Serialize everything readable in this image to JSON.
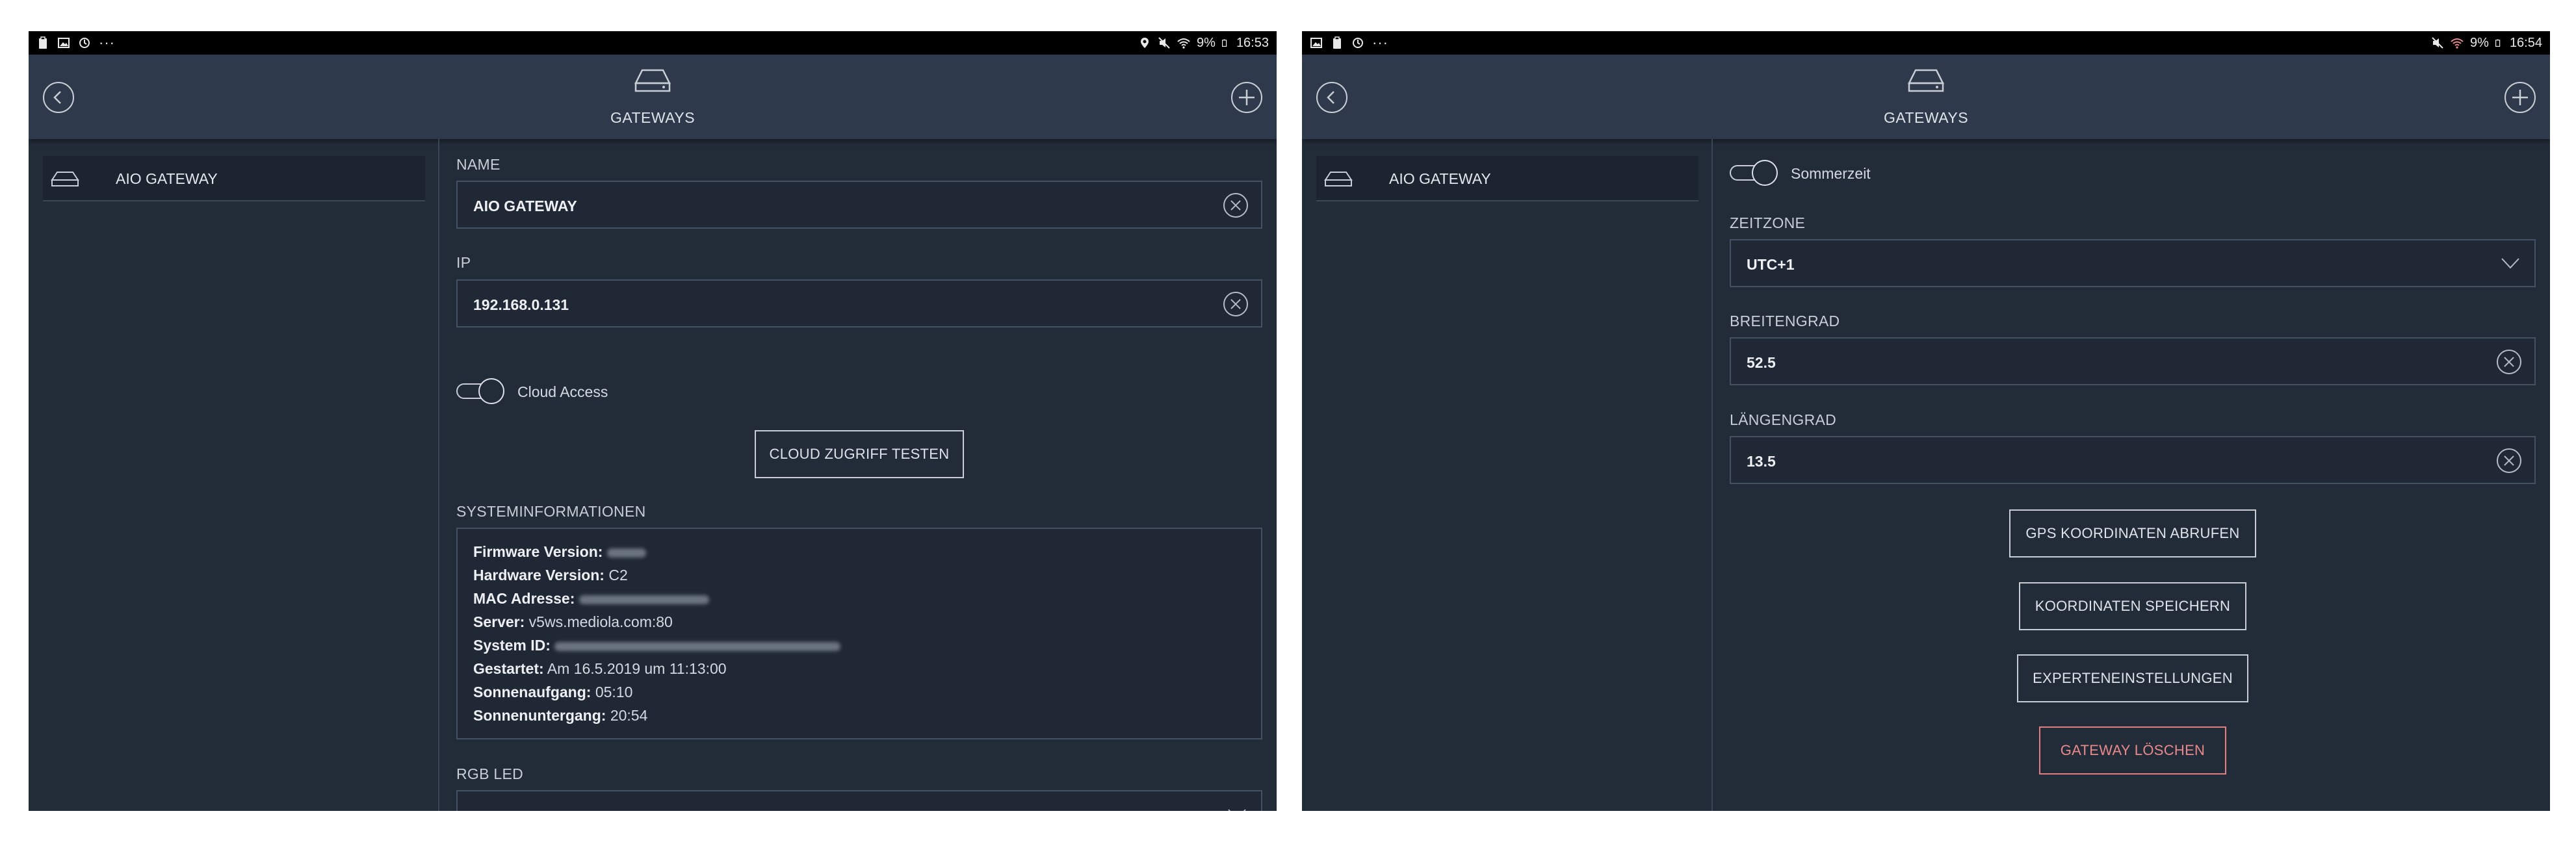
{
  "left": {
    "status": {
      "battery": "9%",
      "time": "16:53"
    },
    "title": "GATEWAYS",
    "sidebar_item": "AIO GATEWAY",
    "name_label": "NAME",
    "name_value": "AIO GATEWAY",
    "ip_label": "IP",
    "ip_value": "192.168.0.131",
    "cloud_access_label": "Cloud Access",
    "cloud_test_button": "CLOUD ZUGRIFF TESTEN",
    "sysinfo_label": "SYSTEMINFORMATIONEN",
    "sysinfo": {
      "firmware_key": "Firmware Version:",
      "hardware_key": "Hardware Version:",
      "hardware_val": "C2",
      "mac_key": "MAC Adresse:",
      "server_key": "Server:",
      "server_val": "v5ws.mediola.com:80",
      "system_id_key": "System ID:",
      "started_key": "Gestartet:",
      "started_val": "Am 16.5.2019 um 11:13:00",
      "sunrise_key": "Sonnenaufgang:",
      "sunrise_val": "05:10",
      "sunset_key": "Sonnenuntergang:",
      "sunset_val": "20:54"
    },
    "rgb_label": "RGB LED"
  },
  "right": {
    "status": {
      "battery": "9%",
      "time": "16:54"
    },
    "title": "GATEWAYS",
    "sidebar_item": "AIO GATEWAY",
    "dst_label": "Sommerzeit",
    "timezone_label": "ZEITZONE",
    "timezone_value": "UTC+1",
    "lat_label": "BREITENGRAD",
    "lat_value": "52.5",
    "lon_label": "LÄNGENGRAD",
    "lon_value": "13.5",
    "gps_button": "GPS KOORDINATEN ABRUFEN",
    "save_button": "KOORDINATEN SPEICHERN",
    "expert_button": "EXPERTENEINSTELLUNGEN",
    "delete_button": "GATEWAY LÖSCHEN"
  },
  "colors": {
    "background": "#222b38",
    "appbar": "#2e3a4b",
    "danger": "#e07f80"
  }
}
